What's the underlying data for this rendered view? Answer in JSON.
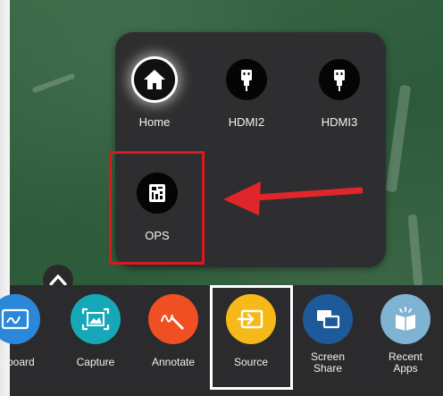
{
  "popup": {
    "sources": [
      {
        "label": "Home",
        "icon": "home-icon",
        "active": true
      },
      {
        "label": "HDMI2",
        "icon": "hdmi-icon"
      },
      {
        "label": "HDMI3",
        "icon": "hdmi-icon"
      },
      {
        "label": "OPS",
        "icon": "ops-icon"
      }
    ]
  },
  "dock": {
    "items": [
      {
        "label": "iteboard",
        "icon": "whiteboard-icon",
        "color": "#2b88d8"
      },
      {
        "label": "Capture",
        "icon": "capture-icon",
        "color": "#16a8b8"
      },
      {
        "label": "Annotate",
        "icon": "annotate-icon",
        "color": "#f04e23"
      },
      {
        "label": "Source",
        "icon": "source-icon",
        "color": "#f6b91a"
      },
      {
        "label_line1": "Screen",
        "label_line2": "Share",
        "icon": "screen-share-icon",
        "color": "#1e5a9a"
      },
      {
        "label_line1": "Recent",
        "label_line2": "Apps",
        "icon": "recent-apps-icon",
        "color": "#7fb3d3"
      }
    ]
  },
  "colors": {
    "highlight_red": "#d8191e",
    "highlight_white": "#ffffff",
    "popup_bg": "#2e2e30"
  }
}
